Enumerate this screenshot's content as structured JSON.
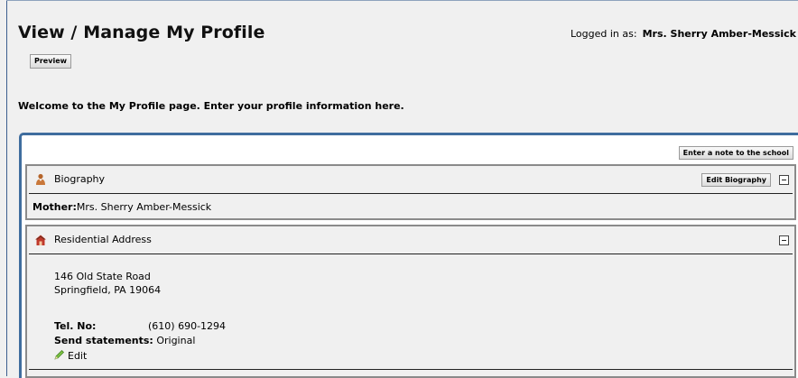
{
  "header": {
    "title": "View / Manage My Profile",
    "logged_in_label": "Logged in as:",
    "logged_in_name": "Mrs. Sherry Amber-Messick",
    "preview_label": "Preview"
  },
  "welcome_text": "Welcome to the My Profile page. Enter your profile information here.",
  "note_button_label": "Enter a note to the school",
  "biography": {
    "title": "Biography",
    "edit_label": "Edit Biography",
    "mother_label": "Mother:",
    "mother_value": "Mrs. Sherry Amber-Messick"
  },
  "address": {
    "title": "Residential Address",
    "line1": "146 Old State Road",
    "line2": "Springfield, PA 19064",
    "tel_label": "Tel. No:",
    "tel_value": "(610) 690-1294",
    "statements_label": "Send statements:",
    "statements_value": "Original",
    "edit_label": "Edit"
  },
  "colors": {
    "frame_blue": "#3f6d9e",
    "section_border": "#8a8a8a",
    "background": "#f0f0f0"
  },
  "icons": {
    "biography": "person-icon",
    "address": "house-icon",
    "edit": "pencil-icon",
    "collapse": "collapse-minus-icon"
  }
}
